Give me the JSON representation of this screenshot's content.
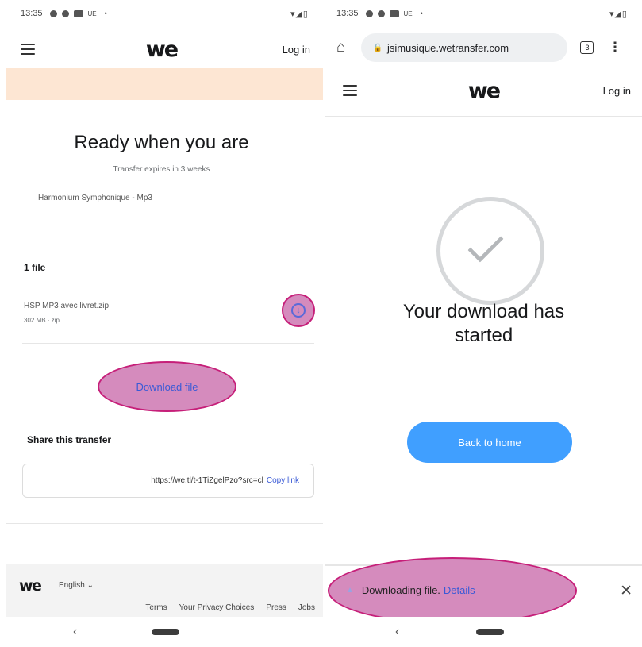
{
  "left": {
    "status": {
      "time": "13:35",
      "carrier": "UE",
      "signal": "▾◢▯"
    },
    "nav": {
      "logo": "we",
      "login": "Log in"
    },
    "hero": {
      "title": "Ready when you are",
      "expires": "Transfer expires in 3 weeks",
      "transfer_name": "Harmonium Symphonique - Mp3"
    },
    "files": {
      "count_label": "1 file",
      "items": [
        {
          "name": "HSP MP3 avec livret.zip",
          "meta": "302 MB · zip"
        }
      ]
    },
    "download_button": "Download file",
    "share": {
      "heading": "Share this transfer",
      "url": "https://we.tl/t-1TiZgelPzo?src=cl",
      "copy": "Copy link"
    },
    "footer": {
      "logo": "we",
      "language": "English",
      "links": [
        "Terms",
        "Your Privacy Choices",
        "Press",
        "Jobs"
      ]
    }
  },
  "right": {
    "status": {
      "time": "13:35",
      "carrier": "UE",
      "signal": "▾◢▯"
    },
    "browser": {
      "url": "jsimusique.wetransfer.com",
      "tab_count": "3"
    },
    "nav": {
      "logo": "we",
      "login": "Log in"
    },
    "message": {
      "line1": "Your download has",
      "line2": "started"
    },
    "back_home": "Back to home",
    "download_bar": {
      "text": "Downloading file.",
      "details": "Details"
    }
  },
  "colors": {
    "accent_blue": "#409fff",
    "link_blue": "#3a5ad6",
    "highlight_fill": "#d58bbd",
    "highlight_stroke": "#c61f79",
    "banner": "#fde6d3"
  },
  "icons": [
    "hamburger-icon",
    "download-arrow-icon",
    "home-icon",
    "lock-icon",
    "tabs-icon",
    "more-vert-icon",
    "check-icon",
    "close-icon",
    "back-icon"
  ]
}
